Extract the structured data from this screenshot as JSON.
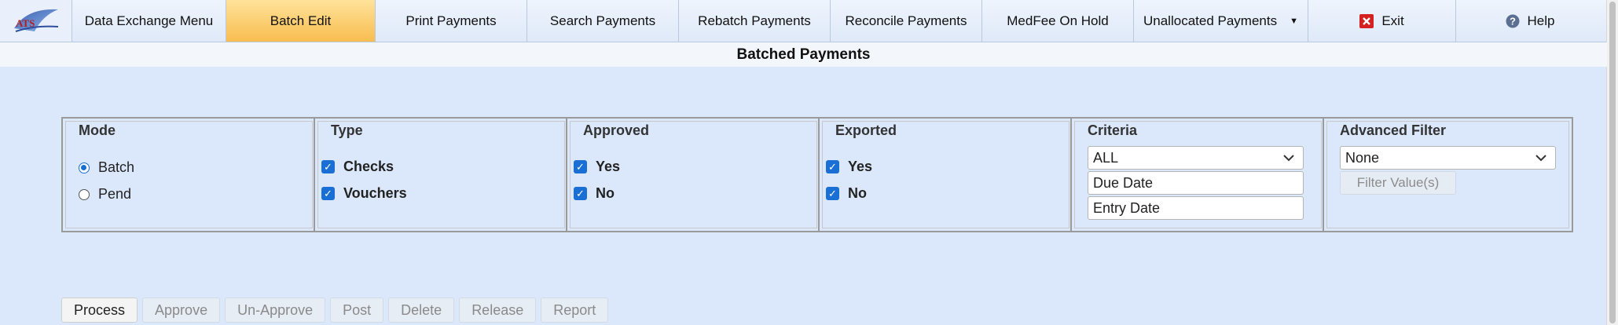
{
  "menu": {
    "logo_text": "ATS",
    "items": [
      {
        "label": "Data Exchange Menu"
      },
      {
        "label": "Batch Edit"
      },
      {
        "label": "Print Payments"
      },
      {
        "label": "Search Payments"
      },
      {
        "label": "Rebatch Payments"
      },
      {
        "label": "Reconcile Payments"
      },
      {
        "label": "MedFee On Hold"
      },
      {
        "label": "Unallocated Payments"
      },
      {
        "label": "Exit"
      },
      {
        "label": "Help"
      }
    ],
    "active_item": "Batch Edit"
  },
  "page_title": "Batched Payments",
  "filters": {
    "mode": {
      "title": "Mode",
      "options": [
        "Batch",
        "Pend"
      ],
      "selected": "Batch"
    },
    "type": {
      "title": "Type",
      "options": [
        "Checks",
        "Vouchers"
      ],
      "checked": [
        true,
        true
      ]
    },
    "approved": {
      "title": "Approved",
      "options": [
        "Yes",
        "No"
      ],
      "checked": [
        true,
        true
      ]
    },
    "exported": {
      "title": "Exported",
      "options": [
        "Yes",
        "No"
      ],
      "checked": [
        true,
        true
      ]
    },
    "criteria": {
      "title": "Criteria",
      "selected": "ALL",
      "field1_value": "Due Date",
      "field2_value": "Entry Date"
    },
    "advanced": {
      "title": "Advanced Filter",
      "selected": "None",
      "button_label": "Filter Value(s)"
    }
  },
  "actions": [
    "Process",
    "Approve",
    "Un-Approve",
    "Post",
    "Delete",
    "Release",
    "Report"
  ],
  "colors": {
    "accent": "#1a6fd4",
    "active_tab": "#f8bd4f",
    "background": "#dbe8fb"
  }
}
